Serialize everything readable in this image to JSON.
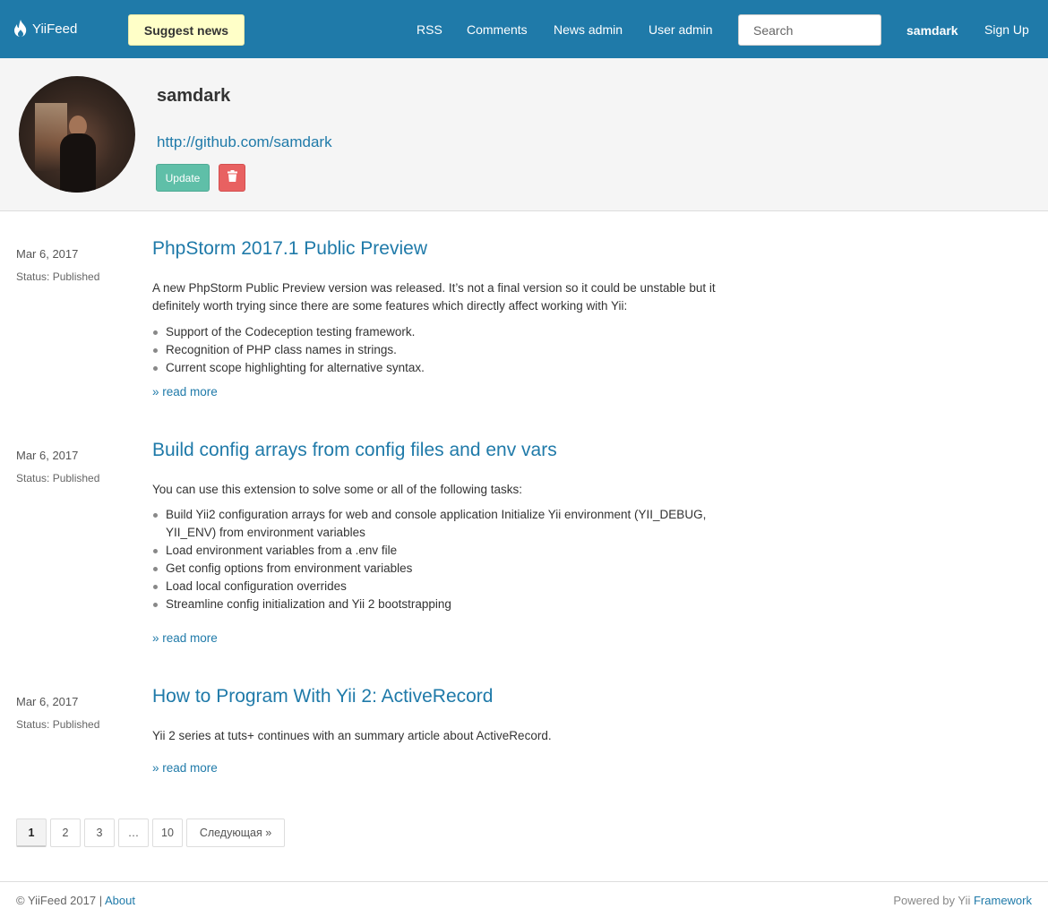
{
  "navbar": {
    "brand": "YiiFeed",
    "suggest_label": "Suggest news",
    "links": [
      "RSS",
      "Comments",
      "News admin",
      "User admin"
    ],
    "search_placeholder": "Search",
    "username": "samdark",
    "signup_label": "Sign Up",
    "brand_color": "#1f7aa9",
    "suggest_color": "#ffffc8"
  },
  "profile": {
    "name": "samdark",
    "link": "http://github.com/samdark",
    "update_label": "Update",
    "delete_icon": "trash-icon"
  },
  "posts": [
    {
      "date": "Mar 6, 2017",
      "status": "Status: Published",
      "title": "PhpStorm 2017.1 Public Preview",
      "text": "A new PhpStorm Public Preview version was released. It’s not a final version so it could be unstable but it definitely worth trying since there are some features which directly affect working with Yii:",
      "items": [
        "Support of the Codeception testing framework.",
        "Recognition of PHP class names in strings.",
        "Current scope highlighting for alternative syntax."
      ],
      "read_more": "» read more"
    },
    {
      "date": "Mar 6, 2017",
      "status": "Status: Published",
      "title": "Build config arrays from config files and env vars",
      "text": "You can use this extension to solve some or all of the following tasks:",
      "items": [
        "Build Yii2 configuration arrays for web and console application Initialize Yii environment (YII_DEBUG, YII_ENV) from environment variables",
        "Load environment variables from a .env file",
        "Get config options from environment variables",
        "Load local configuration overrides",
        "Streamline config initialization and Yii 2 bootstrapping"
      ],
      "read_more": "» read more"
    },
    {
      "date": "Mar 6, 2017",
      "status": "Status: Published",
      "title": "How to Program With Yii 2: ActiveRecord",
      "text": "Yii 2 series at tuts+ continues with an summary article about ActiveRecord.",
      "items": [],
      "read_more": "» read more"
    }
  ],
  "pagination": {
    "pages": [
      "1",
      "2",
      "3",
      "…",
      "10"
    ],
    "active": "1",
    "next_label": "Следующая »"
  },
  "footer": {
    "copyright": "© YiiFeed 2017 |",
    "about": "About",
    "powered": "Powered by Yii",
    "framework": "Framework"
  }
}
